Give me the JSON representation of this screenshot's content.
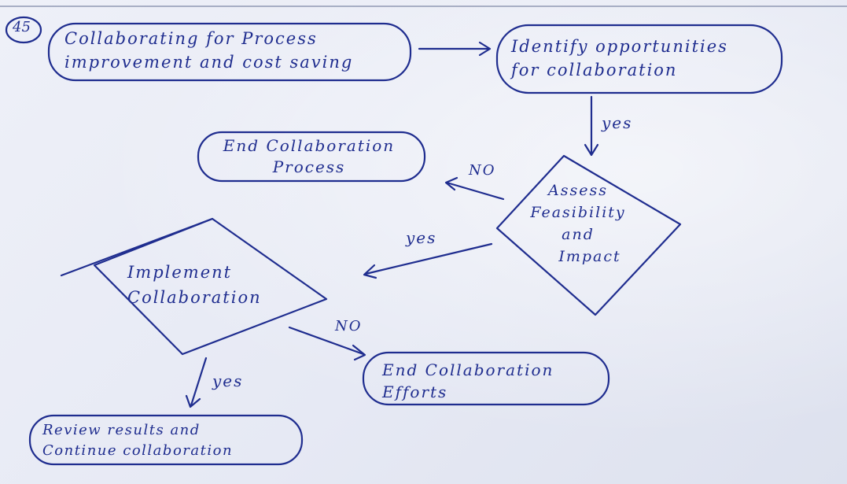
{
  "step_number": "45",
  "nodes": {
    "start": {
      "lines": [
        "Collaborating for Process",
        "improvement and cost saving"
      ]
    },
    "identify": {
      "lines": [
        "Identify opportunities",
        "for collaboration"
      ]
    },
    "assess": {
      "lines": [
        "Assess",
        "Feasibility",
        "and",
        "Impact"
      ]
    },
    "end_process": {
      "lines": [
        "End Collaboration",
        "Process"
      ]
    },
    "implement": {
      "lines": [
        "Implement",
        "Collaboration"
      ]
    },
    "end_efforts": {
      "lines": [
        "End Collaboration",
        "Efforts"
      ]
    },
    "review": {
      "lines": [
        "Review results and",
        "Continue collaboration"
      ]
    }
  },
  "edge_labels": {
    "identify_to_assess": "yes",
    "assess_to_end_process": "NO",
    "assess_to_implement": "yes",
    "implement_to_end_efforts": "NO",
    "implement_to_review": "yes"
  },
  "colors": {
    "ink": "#1f2d8f",
    "paper": "#e9ecf6"
  }
}
